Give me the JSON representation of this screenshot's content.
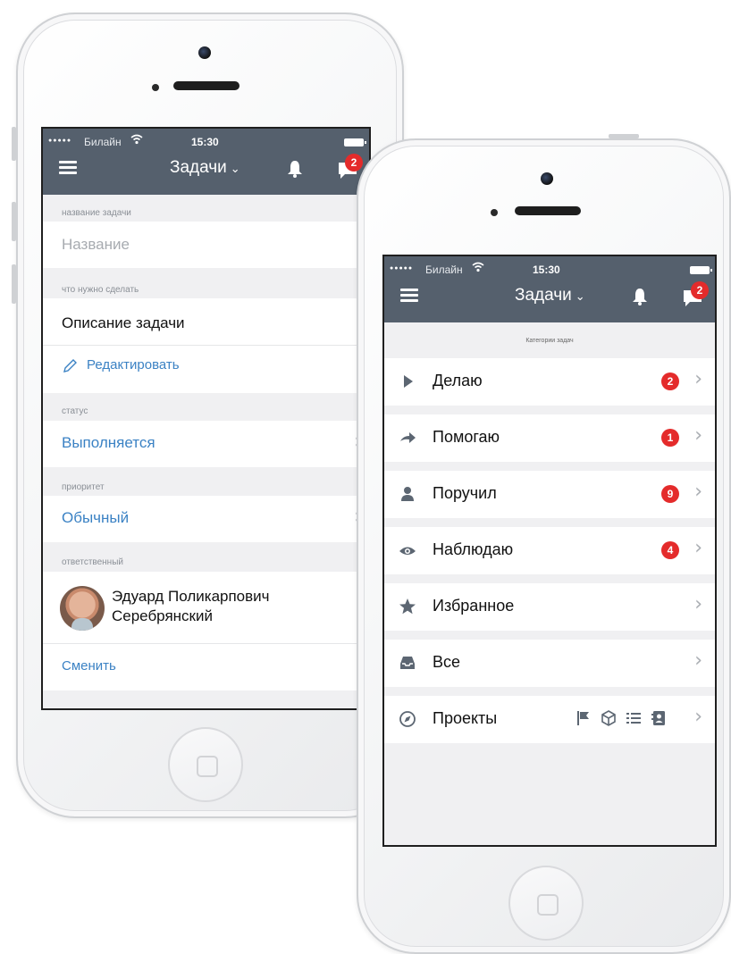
{
  "status_bar": {
    "signal": "●●●●●",
    "carrier": "Билайн",
    "time": "15:30"
  },
  "header": {
    "title": "Задачи",
    "chat_badge": "2"
  },
  "task_form": {
    "name_section": "название задачи",
    "name_placeholder": "Название",
    "todo_section": "что нужно сделать",
    "description": "Описание задачи",
    "edit_link": "Редактировать",
    "status_section": "статус",
    "status_value": "Выполняется",
    "priority_section": "приоритет",
    "priority_value": "Обычный",
    "assignee_section": "ответственный",
    "assignee_name_line1": "Эдуард Поликарпович",
    "assignee_name_line2": "Серебрянский",
    "change_link": "Сменить"
  },
  "categories": {
    "header": "Категории задач",
    "items": [
      {
        "label": "Делаю",
        "icon": "play-icon",
        "badge": "2"
      },
      {
        "label": "Помогаю",
        "icon": "arrow-right-icon",
        "badge": "1"
      },
      {
        "label": "Поручил",
        "icon": "person-icon",
        "badge": "9"
      },
      {
        "label": "Наблюдаю",
        "icon": "eye-icon",
        "badge": "4"
      },
      {
        "label": "Избранное",
        "icon": "star-icon",
        "badge": ""
      },
      {
        "label": "Все",
        "icon": "inbox-icon",
        "badge": ""
      },
      {
        "label": "Проекты",
        "icon": "compass-icon",
        "badge": ""
      }
    ],
    "project_icons": [
      "flag-icon",
      "cube-icon",
      "list-icon",
      "contacts-icon"
    ]
  },
  "colors": {
    "header_bg": "#55606d",
    "accent_blue": "#3b82c4",
    "badge_red": "#e42b2b",
    "screen_bg": "#f0f0f2"
  }
}
